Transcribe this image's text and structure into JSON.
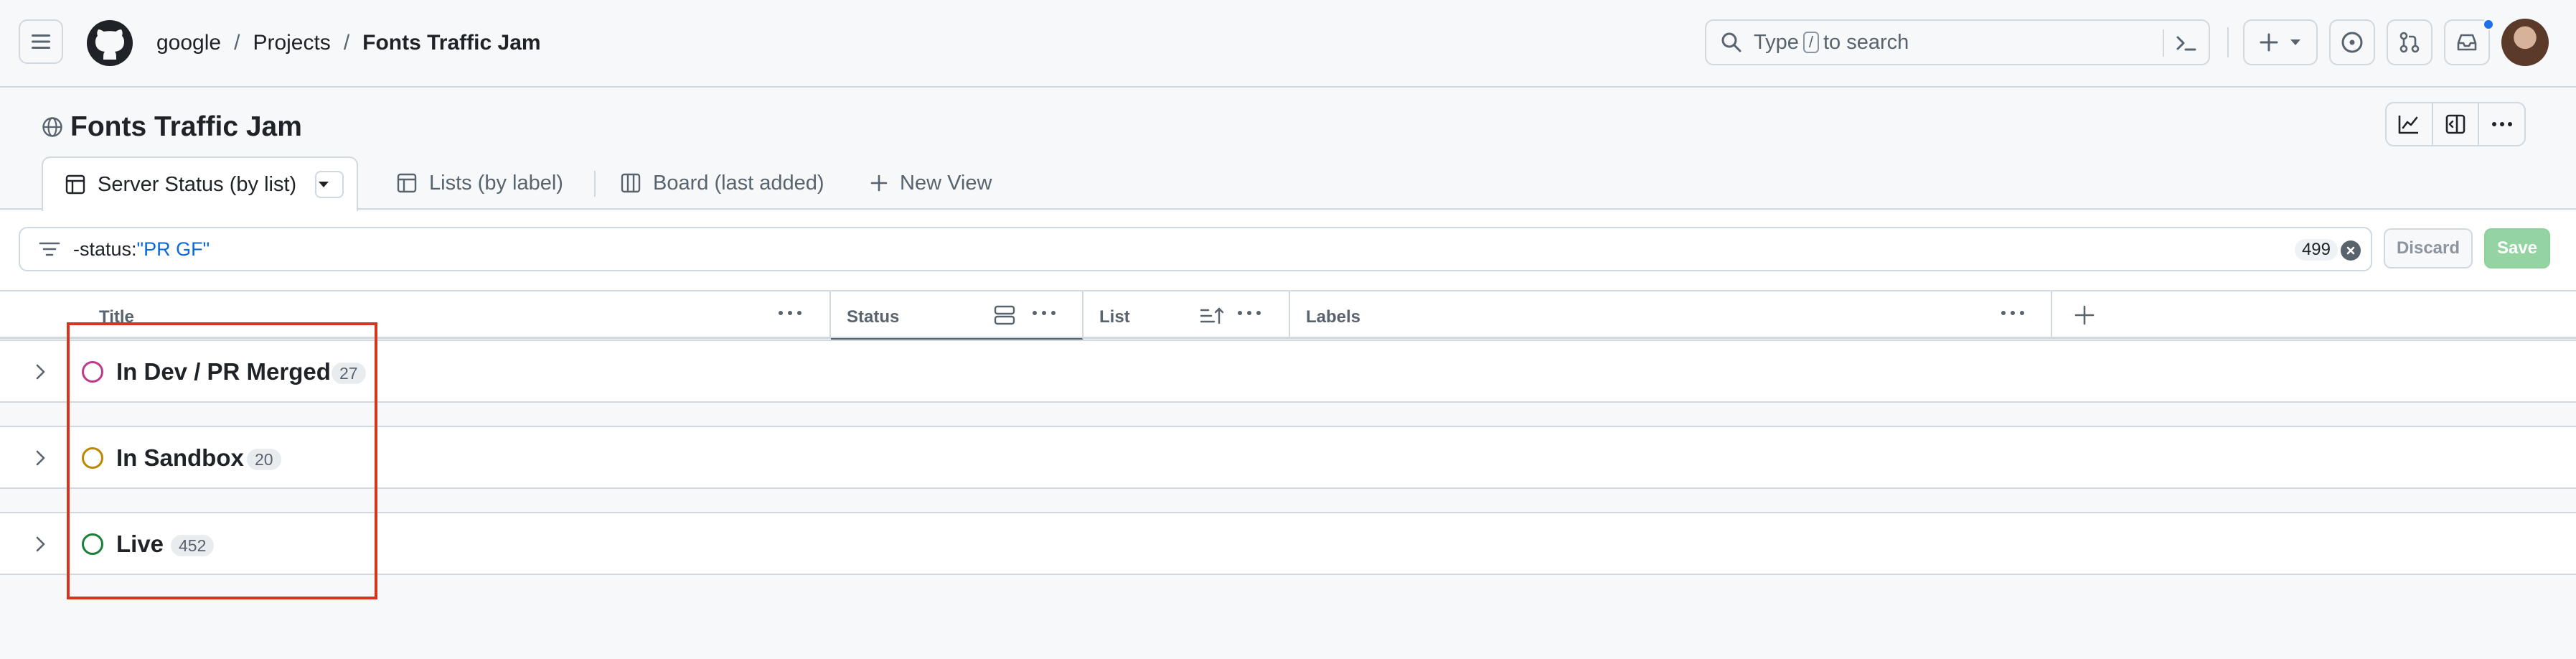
{
  "header": {
    "breadcrumb": [
      "google",
      "Projects",
      "Fonts Traffic Jam"
    ],
    "search": {
      "before": "Type",
      "key": "/",
      "after": "to search"
    }
  },
  "project": {
    "title": "Fonts Traffic Jam"
  },
  "views": [
    {
      "label": "Server Status (by list)",
      "icon": "table-icon",
      "active": true
    },
    {
      "label": "Lists (by label)",
      "icon": "table-icon"
    },
    {
      "label": "Board (last added)",
      "icon": "board-icon"
    },
    {
      "label": "New View",
      "icon": "plus-icon"
    }
  ],
  "filter": {
    "key": "-status:",
    "value": "\"PR GF\"",
    "count": "499",
    "discard_label": "Discard",
    "save_label": "Save"
  },
  "columns": [
    "Title",
    "Status",
    "List",
    "Labels"
  ],
  "groups": [
    {
      "name": "In Dev / PR Merged",
      "count": "27",
      "color": "#bf3989"
    },
    {
      "name": "In Sandbox",
      "count": "20",
      "color": "#bf8700"
    },
    {
      "name": "Live",
      "count": "452",
      "color": "#1a7f37"
    }
  ],
  "colors": {
    "accent": "#0969da",
    "highlight": "#d4351c",
    "save": "#94d3a2"
  }
}
